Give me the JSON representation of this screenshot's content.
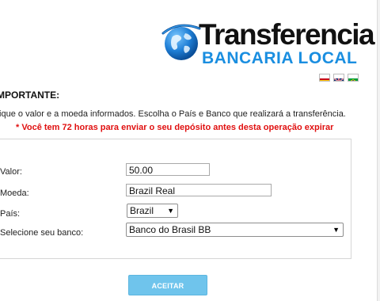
{
  "logo": {
    "title": "Transferencia",
    "subtitle": "BANCARIA LOCAL"
  },
  "languages": [
    {
      "icon": "flag-spain-icon",
      "colors": [
        "#c60b1e",
        "#ffc400"
      ]
    },
    {
      "icon": "flag-uk-icon",
      "colors": [
        "#012169",
        "#c8102e",
        "#ffffff"
      ]
    },
    {
      "icon": "flag-brazil-icon",
      "colors": [
        "#009c3b",
        "#ffdf00",
        "#002776"
      ]
    }
  ],
  "heading": "MPORTANTE:",
  "instructions": "fique o valor e a moeda informados. Escolha o País e Banco que realizará a transferência.",
  "warning": "* Você tem 72 horas para enviar o seu depósito antes desta operação expirar",
  "form": {
    "valor_label": "Valor:",
    "valor_value": "50.00",
    "moeda_label": "Moeda:",
    "moeda_value": "Brazil Real",
    "pais_label": "País:",
    "pais_value": "Brazil",
    "banco_label": "Selecione seu banco:",
    "banco_value": "Banco do Brasil BB"
  },
  "submit_label": "ACEITAR",
  "colors": {
    "brand_blue": "#1a8ee0",
    "warning_red": "#e01010",
    "button_blue": "#6fc4ec"
  }
}
